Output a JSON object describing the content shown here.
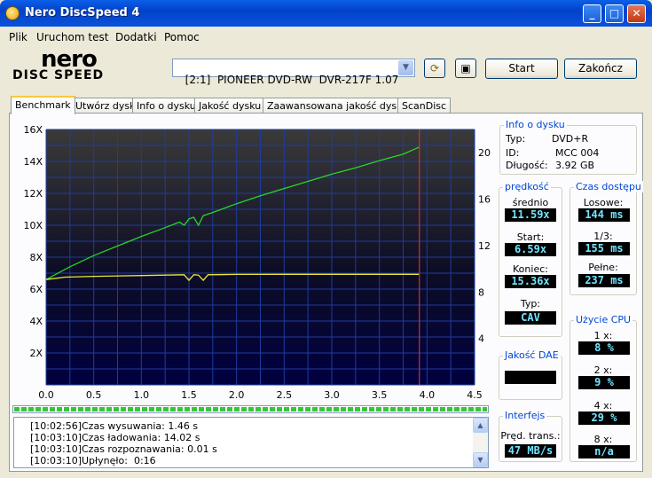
{
  "window": {
    "title": "Nero DiscSpeed 4"
  },
  "menu": [
    "Plik",
    "Uruchom test",
    "Dodatki",
    "Pomoc"
  ],
  "logo": {
    "top": "nero",
    "bottom": "DISC SPEED"
  },
  "toolbar": {
    "drive": "[2:1]  PIONEER DVD-RW  DVR-217F 1.07",
    "start": "Start",
    "end": "Zakończ"
  },
  "tabs": [
    "Benchmark",
    "Utwórz dysk",
    "Info o dysku",
    "Jakość dysku",
    "Zaawansowana jakość dysku",
    "ScanDisc"
  ],
  "chart_data": {
    "type": "line",
    "x_ticks": [
      "0.0",
      "0.5",
      "1.0",
      "1.5",
      "2.0",
      "2.5",
      "3.0",
      "3.5",
      "4.0",
      "4.5"
    ],
    "xlim": [
      0,
      4.5
    ],
    "y_left_ticks": [
      "2X",
      "4X",
      "6X",
      "8X",
      "10X",
      "12X",
      "14X",
      "16X"
    ],
    "ylim_left": [
      0,
      16
    ],
    "y_right_ticks": [
      "4",
      "8",
      "12",
      "16",
      "20"
    ],
    "ylim_right": [
      0,
      22
    ],
    "marker_x": 3.92,
    "series": [
      {
        "color": "#27d627",
        "x": [
          0,
          0.25,
          0.5,
          0.75,
          1.0,
          1.25,
          1.4,
          1.45,
          1.5,
          1.55,
          1.6,
          1.65,
          1.7,
          1.75,
          2.0,
          2.25,
          2.5,
          2.75,
          3.0,
          3.25,
          3.5,
          3.75,
          3.92
        ],
        "y": [
          6.6,
          7.4,
          8.1,
          8.7,
          9.3,
          9.85,
          10.2,
          10.0,
          10.4,
          10.5,
          10.0,
          10.6,
          10.7,
          10.8,
          11.35,
          11.85,
          12.3,
          12.75,
          13.2,
          13.6,
          14.05,
          14.45,
          14.9
        ]
      },
      {
        "color": "#e8e83a",
        "x": [
          0,
          0.2,
          0.5,
          1.0,
          1.45,
          1.5,
          1.55,
          1.6,
          1.65,
          1.7,
          2.0,
          2.5,
          3.0,
          3.5,
          3.92
        ],
        "y": [
          6.6,
          6.75,
          6.8,
          6.85,
          6.9,
          6.55,
          6.9,
          6.88,
          6.55,
          6.9,
          6.92,
          6.93,
          6.93,
          6.93,
          6.93
        ]
      }
    ]
  },
  "progress": {
    "fraction": 1.0
  },
  "log": [
    {
      "time": "[10:02:56]",
      "text": "Czas wysuwania: 1.46 s"
    },
    {
      "time": "[10:03:10]",
      "text": "Czas ładowania: 14.02 s"
    },
    {
      "time": "[10:03:10]",
      "text": "Czas rozpoznawania: 0.01 s"
    },
    {
      "time": "[10:03:10]",
      "text": "Upłynęło:  0:16"
    }
  ],
  "disc_info": {
    "title": "Info o dysku",
    "type_label": "Typ:",
    "type": "DVD+R",
    "id_label": "ID:",
    "id": "MCC 004",
    "length_label": "Długość:",
    "length": "3.92 GB"
  },
  "speed": {
    "title": "prędkość",
    "avg_label": "średnio",
    "avg": "11.59x",
    "start_label": "Start:",
    "start": "6.59x",
    "end_label": "Koniec:",
    "end": "15.36x",
    "type_label": "Typ:",
    "type": "CAV"
  },
  "access": {
    "title": "Czas dostępu",
    "random_label": "Losowe:",
    "random": "144 ms",
    "third_label": "1/3:",
    "third": "155 ms",
    "full_label": "Pełne:",
    "full": "237 ms"
  },
  "dae": {
    "title": "Jakość DAE",
    "value": ""
  },
  "cpu": {
    "title": "Użycie CPU",
    "r1_label": "1 x:",
    "r1": "8 %",
    "r2_label": "2 x:",
    "r2": "9 %",
    "r4_label": "4 x:",
    "r4": "29 %",
    "r8_label": "8 x:",
    "r8": "n/a"
  },
  "interface": {
    "title": "Interfejs",
    "burst_label": "Pręd. trans.:",
    "burst": "47 MB/s"
  }
}
